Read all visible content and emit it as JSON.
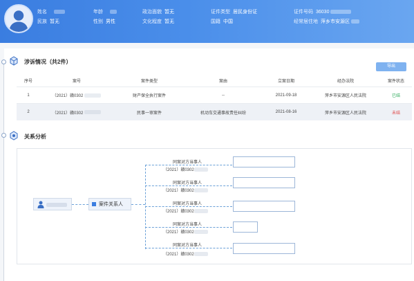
{
  "header": {
    "fields": [
      {
        "label": "姓名",
        "value": ""
      },
      {
        "label": "年龄",
        "value": ""
      },
      {
        "label": "政治面貌",
        "value": "暂无"
      },
      {
        "label": "证件类型",
        "value": "居民身份证"
      },
      {
        "label": "证件号码",
        "value": "36030"
      },
      {
        "label": "民族",
        "value": "暂无"
      },
      {
        "label": "性别",
        "value": "男性"
      },
      {
        "label": "文化程度",
        "value": "暂无"
      },
      {
        "label": "国籍",
        "value": "中国"
      },
      {
        "label": "经常居住地",
        "value": "萍乡市安源区"
      }
    ]
  },
  "cases": {
    "title": "涉诉情况（共2件）",
    "export_label": "导出",
    "columns": [
      "序号",
      "案号",
      "案件类型",
      "案由",
      "立案日期",
      "经办法院",
      "案件状态"
    ],
    "rows": [
      {
        "no": "1",
        "case_no": "（2021）赣0302",
        "type": "财产保全执行案件",
        "cause": "--",
        "date": "2021-09-18",
        "court": "萍乡市安源区人民法院",
        "status": "已结"
      },
      {
        "no": "2",
        "case_no": "（2021）赣0302",
        "type": "民事一审案件",
        "cause": "机动车交通事故责任纠纷",
        "date": "2021-08-16",
        "court": "萍乡市安源区人民法院",
        "status": "未结"
      }
    ]
  },
  "relation": {
    "title": "关系分析",
    "center_label": "案件关系人",
    "branches": [
      {
        "line1": "同案对方当事人",
        "line2": "（2021）赣0302"
      },
      {
        "line1": "同案对方当事人",
        "line2": "（2021）赣0302"
      },
      {
        "line1": "同案对方当事人",
        "line2": "（2021）赣0302"
      },
      {
        "line1": "同案对方当事人",
        "line2": "（2021）赣0302"
      },
      {
        "line1": "同案对方当事人",
        "line2": "（2021）赣0302"
      }
    ]
  },
  "colors": {
    "header_blue": "#3a7de0",
    "status_closed": "#2eaa5b",
    "status_open": "#e04545"
  },
  "icons": [
    "avatar-icon",
    "case-icon",
    "relation-icon",
    "person-icon",
    "case-person-icon"
  ]
}
